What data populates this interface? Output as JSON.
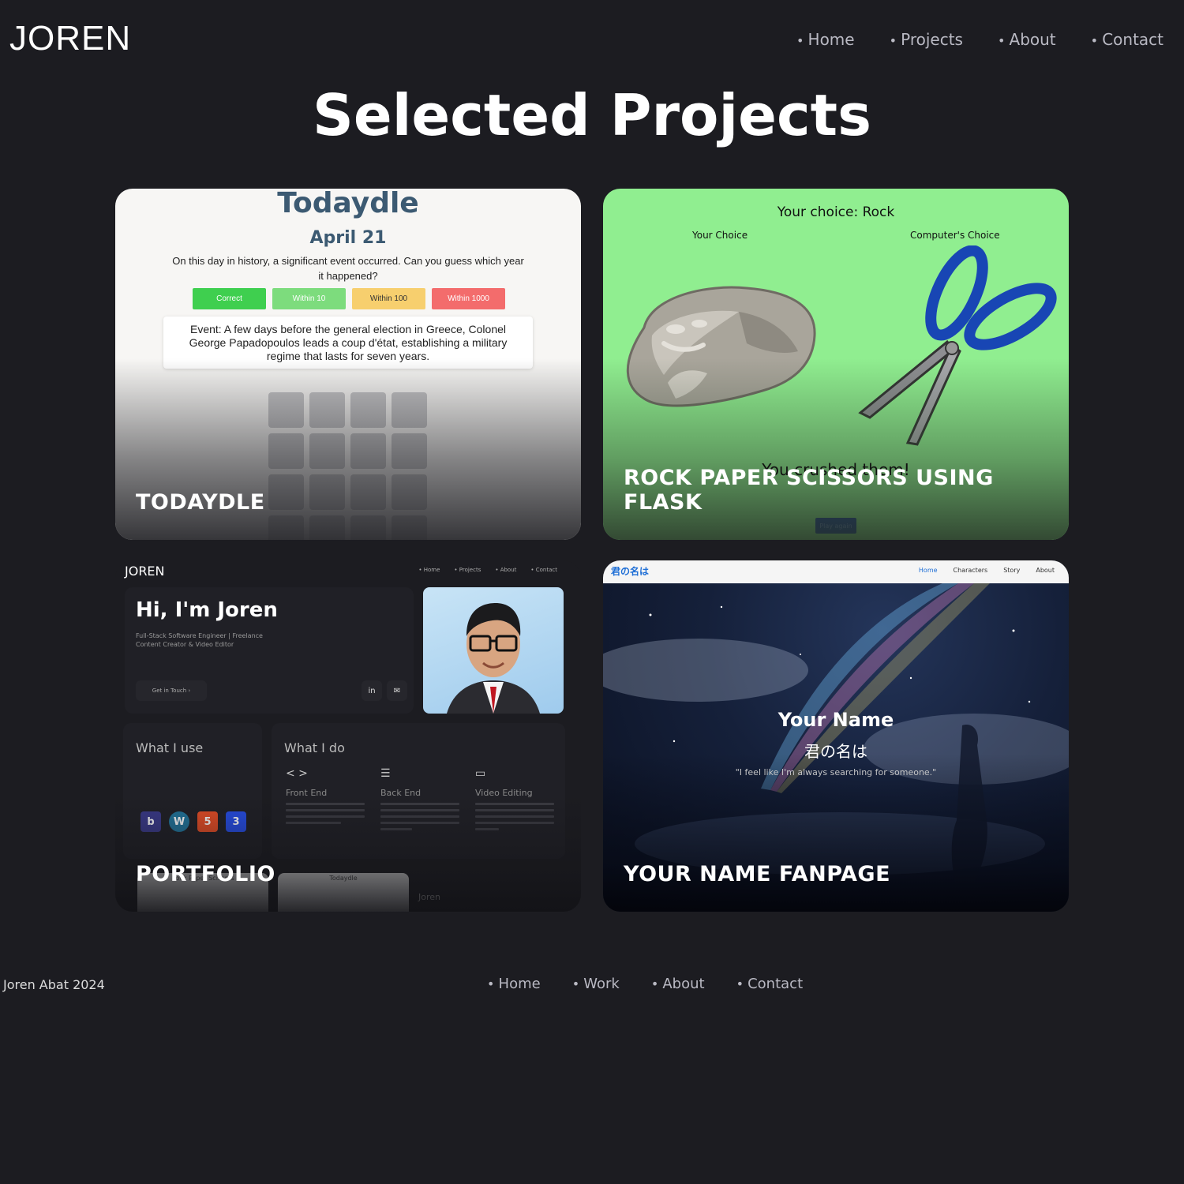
{
  "header": {
    "logo": "JOREN",
    "nav": [
      "Home",
      "Projects",
      "About",
      "Contact"
    ]
  },
  "page": {
    "title": "Selected Projects"
  },
  "projects": {
    "todaydle": {
      "caption": "TODAYDLE",
      "app_title": "Todaydle",
      "date": "April 21",
      "description": "On this day in history, a significant event occurred. Can you guess which year it happened?",
      "legend": [
        "Correct",
        "Within 10",
        "Within 100",
        "Within 1000"
      ],
      "event": "Event: A few days before the general election in Greece, Colonel George Papadopoulos leads a coup d'état, establishing a military regime that lasts for seven years."
    },
    "rps": {
      "caption": "ROCK PAPER SCISSORS USING FLASK",
      "your_choice": "Your choice: Rock",
      "label_you": "Your Choice",
      "label_computer": "Computer's Choice",
      "result": "You crushed them!",
      "play_again": "Play again"
    },
    "portfolio": {
      "caption": "PORTFOLIO",
      "logo": "JOREN",
      "nav": [
        "• Home",
        "• Projects",
        "• About",
        "• Contact"
      ],
      "hero_title": "Hi, I'm Joren",
      "hero_sub_1": "Full-Stack Software Engineer | Freelance",
      "hero_sub_2": "Content Creator & Video Editor",
      "get_in_touch": "Get in Touch  ›",
      "use_heading": "What I use",
      "do_heading": "What I do",
      "front_end": "Front End",
      "back_end": "Back End",
      "video_editing": "Video Editing",
      "thumb_rps": "Rock Paper Scissors",
      "thumb_todaydle": "Todaydle",
      "thumb_joren": "Joren"
    },
    "yourname": {
      "caption": "YOUR NAME FANPAGE",
      "brand": "君の名は",
      "nav": [
        "Home",
        "Characters",
        "Story",
        "About"
      ],
      "title": "Your Name",
      "jp_title": "君の名は",
      "quote": "\"I feel like I'm always searching for someone.\""
    }
  },
  "footer": {
    "copyright": "Joren Abat 2024",
    "nav": [
      "Home",
      "Work",
      "About",
      "Contact"
    ]
  },
  "colors": {
    "background": "#1c1c21",
    "correct": "#3fcf4f",
    "within10": "#7ddc7d",
    "within100": "#f7cf6e",
    "within1000": "#f36c6c",
    "rps_bg": "#90ee90",
    "scissor_handle": "#1846b4"
  }
}
